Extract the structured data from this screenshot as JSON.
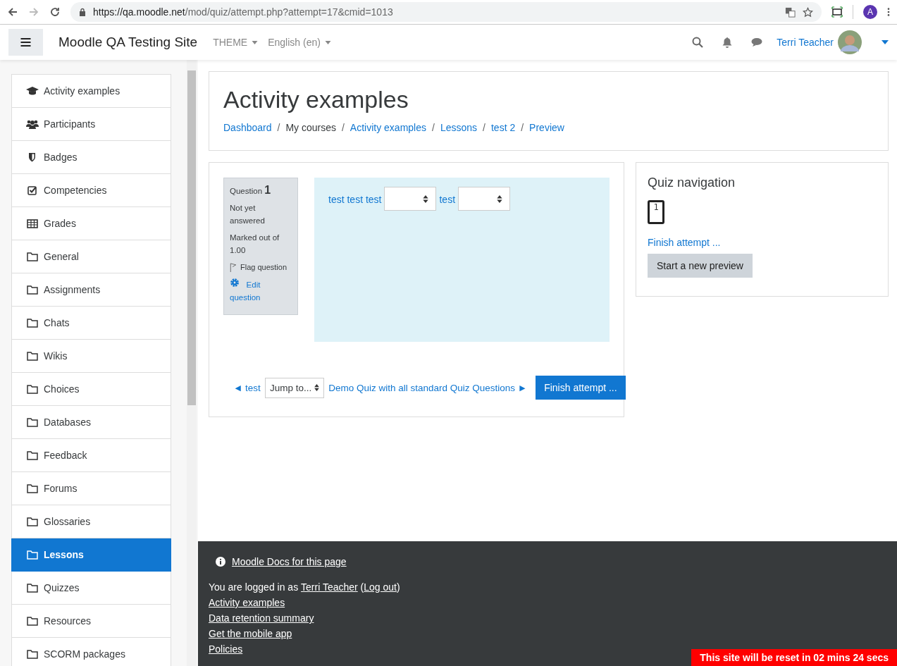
{
  "browser": {
    "url_host": "https://qa.moodle.net",
    "url_path": "/mod/quiz/attempt.php?attempt=17&cmid=1013",
    "profile": "A"
  },
  "navbar": {
    "site_name": "Moodle QA Testing Site",
    "menus": [
      "THEME",
      "English (en)"
    ],
    "user_name": "Terri Teacher"
  },
  "sidebar": {
    "items": [
      {
        "label": "Activity examples",
        "selected": false
      },
      {
        "label": "Participants",
        "selected": false
      },
      {
        "label": "Badges",
        "selected": false
      },
      {
        "label": "Competencies",
        "selected": false
      },
      {
        "label": "Grades",
        "selected": false
      },
      {
        "label": "General",
        "selected": false
      },
      {
        "label": "Assignments",
        "selected": false
      },
      {
        "label": "Chats",
        "selected": false
      },
      {
        "label": "Wikis",
        "selected": false
      },
      {
        "label": "Choices",
        "selected": false
      },
      {
        "label": "Databases",
        "selected": false
      },
      {
        "label": "Feedback",
        "selected": false
      },
      {
        "label": "Forums",
        "selected": false
      },
      {
        "label": "Glossaries",
        "selected": false
      },
      {
        "label": "Lessons",
        "selected": true
      },
      {
        "label": "Quizzes",
        "selected": false
      },
      {
        "label": "Resources",
        "selected": false
      },
      {
        "label": "SCORM packages",
        "selected": false
      }
    ]
  },
  "header": {
    "title": "Activity examples",
    "breadcrumbs": [
      {
        "label": "Dashboard",
        "link": true,
        "separator": "/"
      },
      {
        "label": "My courses",
        "link": false,
        "separator": "/"
      },
      {
        "label": "Activity examples",
        "link": true,
        "separator": "/"
      },
      {
        "label": "Lessons",
        "link": true,
        "separator": "/"
      },
      {
        "label": "test 2",
        "link": true,
        "separator": "/"
      },
      {
        "label": "Preview",
        "link": true
      }
    ]
  },
  "question": {
    "label": "Question",
    "number": "1",
    "status": "Not yet answered",
    "marked": "Marked out of 1.00",
    "flag": "Flag question",
    "edit": "Edit question",
    "text_1": "test test test",
    "text_2": "test"
  },
  "nav": {
    "prev": "◄ test",
    "next": "Demo Quiz with all standard Quiz Questions ►",
    "jump": "Jump to...",
    "finish": "Finish attempt ..."
  },
  "quiz_navigation": {
    "title": "Quiz navigation",
    "questions": [
      {
        "label": "1",
        "selected": true
      }
    ],
    "finish_link": "Finish attempt ...",
    "new_preview": "Start a new preview"
  },
  "footer": {
    "docs": "Moodle Docs for this page",
    "logged_prefix": "You are logged in as",
    "user": "Terri Teacher",
    "logout": "Log out",
    "paren_open": "(",
    "paren_close": ")",
    "links": [
      "Activity examples",
      "Data retention summary",
      "Get the mobile app",
      "Policies"
    ]
  },
  "reset_notice": "This site will be reset in 02 mins 24 secs"
}
